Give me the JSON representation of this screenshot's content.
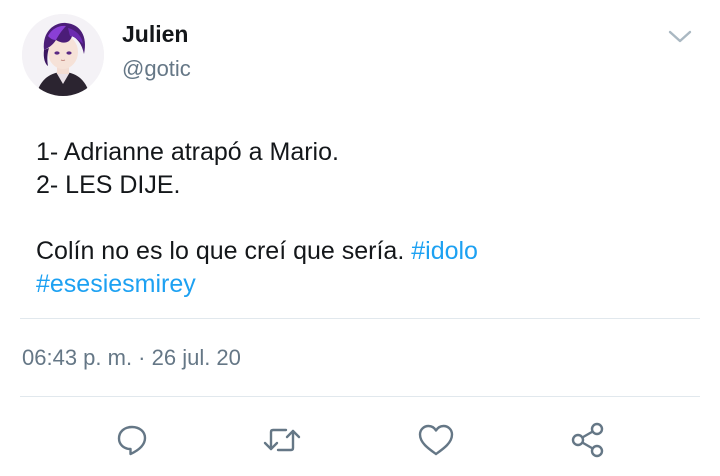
{
  "tweet": {
    "author": {
      "display_name": "Julien",
      "handle": "@gotic"
    },
    "text_lines": [
      "1- Adrianne atrapó a Mario.",
      "2- LES DIJE."
    ],
    "text_line3_plain": "Colín no es lo que creí que sería. ",
    "hashtags": [
      "#idolo",
      "#esesiesmirey"
    ],
    "timestamp": "06:43 p. m. · 26 jul. 20"
  },
  "icons": {
    "menu": "chevron-down-icon",
    "reply": "reply-icon",
    "retweet": "retweet-icon",
    "like": "heart-icon",
    "share": "share-icon"
  },
  "colors": {
    "hashtag": "#1da1f2",
    "secondary_text": "#657786",
    "icon": "#657786",
    "divider": "#e1e8ed"
  }
}
